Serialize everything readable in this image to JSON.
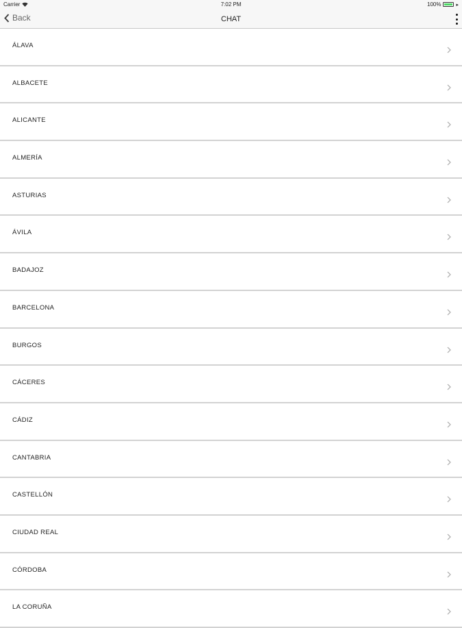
{
  "status_bar": {
    "carrier": "Carrier",
    "time": "7:02 PM",
    "battery": "100%",
    "icons": [
      "wifi-icon",
      "battery-icon",
      "charge-icon"
    ],
    "battery_color": "#4cd964"
  },
  "nav": {
    "back_label": "Back",
    "title": "CHAT",
    "icons": [
      "back-chevron-icon",
      "more-vertical-icon"
    ]
  },
  "provinces": [
    {
      "label": "ÁLAVA"
    },
    {
      "label": "ALBACETE"
    },
    {
      "label": "ALICANTE"
    },
    {
      "label": "ALMERÍA"
    },
    {
      "label": "ASTURIAS"
    },
    {
      "label": "ÁVILA"
    },
    {
      "label": "BADAJOZ"
    },
    {
      "label": "BARCELONA"
    },
    {
      "label": "BURGOS"
    },
    {
      "label": "CÁCERES"
    },
    {
      "label": "CÁDIZ"
    },
    {
      "label": "CANTABRIA"
    },
    {
      "label": "CASTELLÓN"
    },
    {
      "label": "CIUDAD REAL"
    },
    {
      "label": "CÓRDOBA"
    },
    {
      "label": "LA CORUÑA"
    }
  ],
  "row_icon": "chevron-right-icon"
}
